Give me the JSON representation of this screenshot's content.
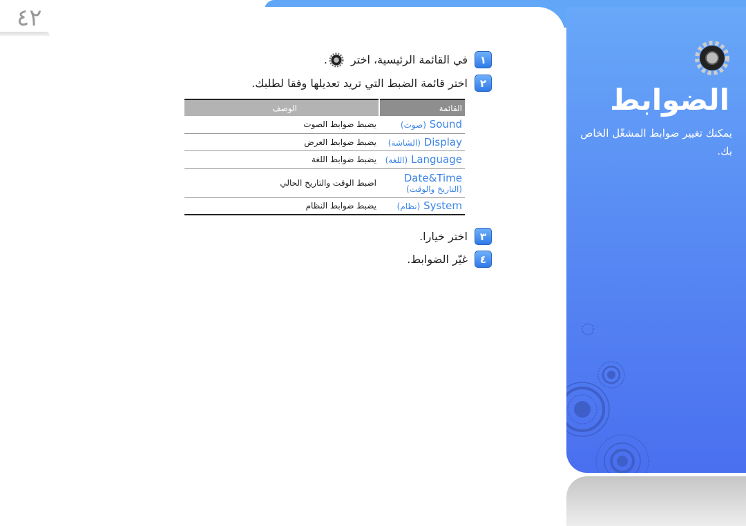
{
  "page_number": "٤٢",
  "sidebar": {
    "title": "الضوابط",
    "subtitle": "يمكنك تغيير ضوابط المشغّل الخاص بك.",
    "icon": "gear-icon"
  },
  "steps": [
    {
      "num": "١",
      "text": "في القائمة الرئيسية، اختر",
      "suffix": ".",
      "icon": "gear-icon"
    },
    {
      "num": "٢",
      "text": "اختر قائمة الضبط التي تريد تعديلها وفقا لطلبك."
    },
    {
      "num": "٣",
      "text": "اختر خيارا."
    },
    {
      "num": "٤",
      "text": "غيّر الضوابط."
    }
  ],
  "table": {
    "headers": [
      "القائمة",
      "الوصف"
    ],
    "rows": [
      {
        "name": "Sound",
        "name_ar": "(صوت)",
        "desc": "يضبط ضوابط الصوت"
      },
      {
        "name": "Display",
        "name_ar": "(الشاشة)",
        "desc": "يضبط ضوابط العرض"
      },
      {
        "name": "Language",
        "name_ar": "(اللغة)",
        "desc": "يضبط ضوابط اللغة"
      },
      {
        "name": "Date&Time",
        "name_ar": "(التاريخ والوقت)",
        "desc": "اضبط الوقت والتاريخ الحالي"
      },
      {
        "name": "System",
        "name_ar": "(نظام)",
        "desc": "يضبط ضوابط النظام"
      }
    ]
  },
  "colors": {
    "accent": "#3d84e6",
    "panel": "#5a8ff4",
    "badge": "#2f7ae8"
  }
}
